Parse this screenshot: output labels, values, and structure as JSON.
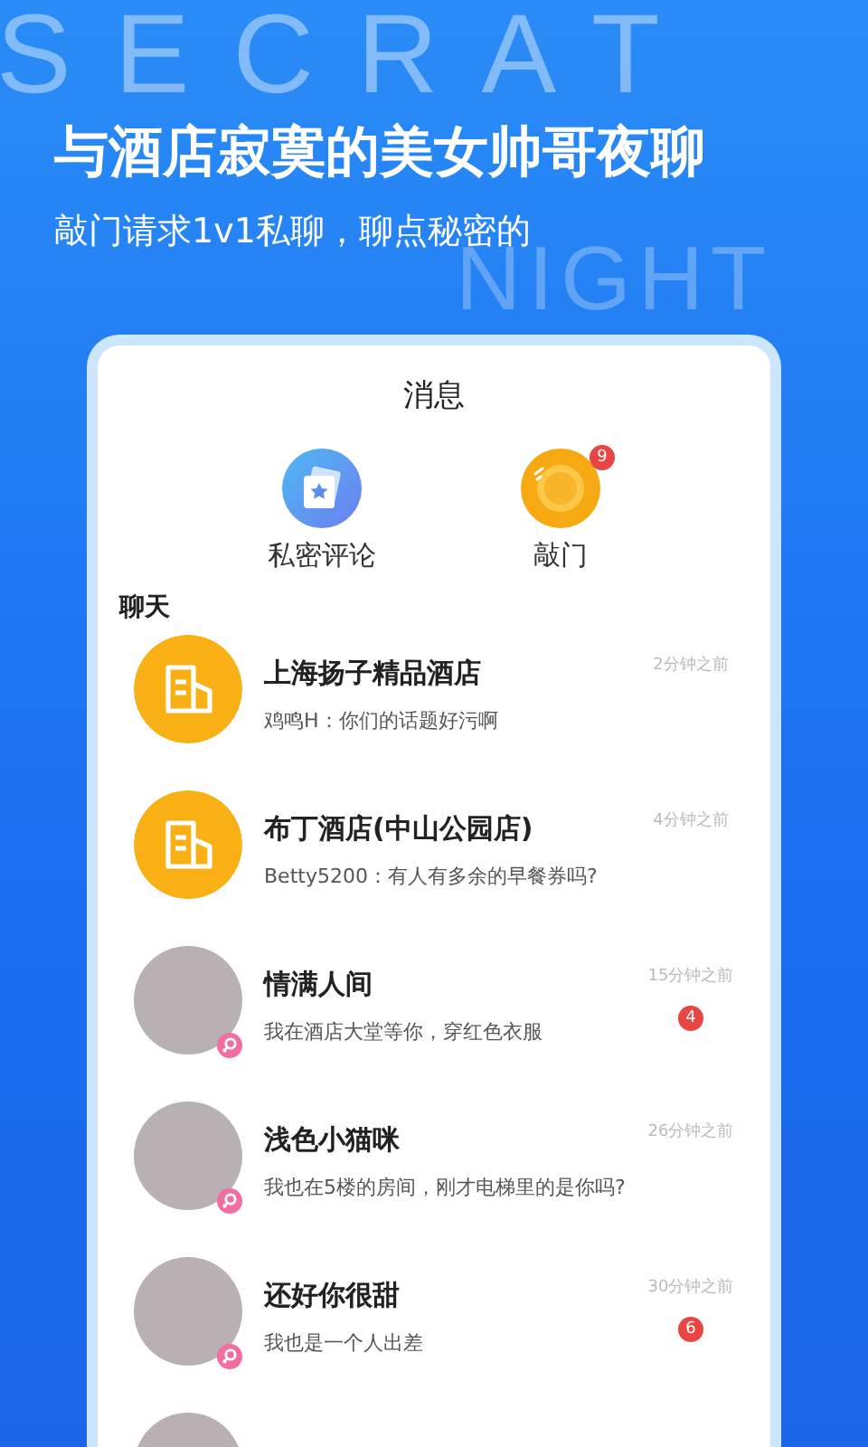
{
  "backdrop_words": [
    "SECRAT",
    "NIGHT"
  ],
  "headline": "与酒店寂寞的美女帅哥夜聊",
  "subheadline": "敲门请求1v1私聊，聊点秘密的",
  "screen": {
    "title": "消息",
    "shortcuts": [
      {
        "kind": "review",
        "label": "私密评论"
      },
      {
        "kind": "knock",
        "label": "敲门",
        "badge": "9"
      }
    ],
    "section_title": "聊天",
    "chats": [
      {
        "kind": "hotel",
        "name": "上海扬子精品酒店",
        "message": "鸡鸣H：你们的话题好污啊",
        "time": "2分钟之前"
      },
      {
        "kind": "hotel",
        "name": "布丁酒店(中山公园店)",
        "message": "Betty5200：有人有多余的早餐券吗?",
        "time": "4分钟之前"
      },
      {
        "kind": "person",
        "name": "情满人间",
        "message": "我在酒店大堂等你，穿红色衣服",
        "time": "15分钟之前",
        "badge": "4"
      },
      {
        "kind": "person",
        "name": "浅色小猫咪",
        "message": "我也在5楼的房间，刚才电梯里的是你吗?",
        "time": "26分钟之前"
      },
      {
        "kind": "person",
        "name": "还好你很甜",
        "message": "我也是一个人出差",
        "time": "30分钟之前",
        "badge": "6"
      },
      {
        "kind": "person"
      }
    ]
  }
}
